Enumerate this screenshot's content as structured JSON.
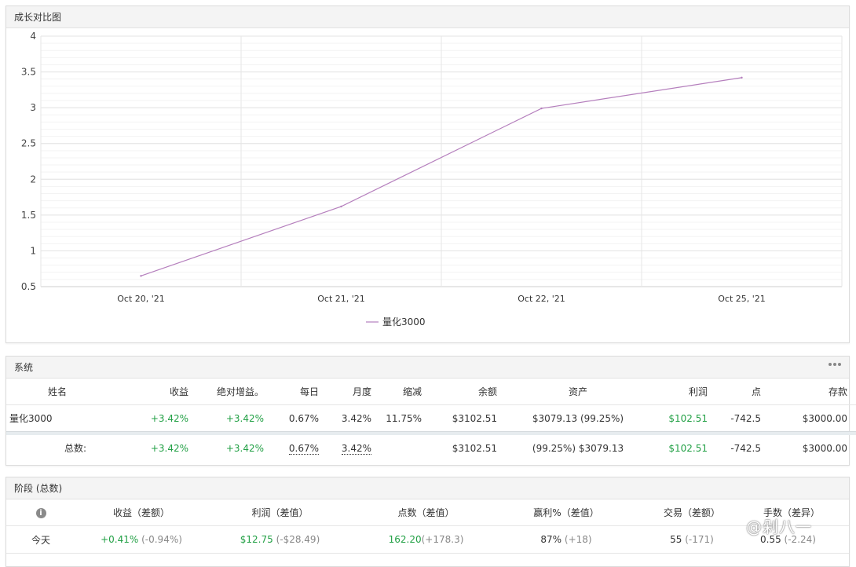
{
  "chart_panel": {
    "title": "成长对比图"
  },
  "chart_data": {
    "type": "line",
    "x": [
      "Oct 20, '21",
      "Oct 21, '21",
      "Oct 22, '21",
      "Oct 25, '21"
    ],
    "series": [
      {
        "name": "量化3000",
        "values": [
          0.65,
          1.62,
          2.99,
          3.42
        ],
        "color": "#b57fbd"
      }
    ],
    "yticks": [
      "4",
      "3.5",
      "3",
      "2.5",
      "2",
      "1.5",
      "1",
      "0.5"
    ],
    "ylim": [
      0.5,
      4
    ],
    "grid": true,
    "legend": "bottom-center"
  },
  "system": {
    "title": "系统",
    "headers": [
      "姓名",
      "收益",
      "绝对增益。",
      "每日",
      "月度",
      "缩减",
      "余额",
      "资产",
      "利润",
      "点",
      "存款"
    ],
    "row": [
      "量化3000",
      "+3.42%",
      "+3.42%",
      "0.67%",
      "3.42%",
      "11.75%",
      "$3102.51",
      "$3079.13 (99.25%)",
      "$102.51",
      "-742.5",
      "$3000.00"
    ],
    "total": [
      "总数:",
      "+3.42%",
      "+3.42%",
      "0.67%",
      "3.42%",
      "",
      "$3102.51",
      "(99.25%) $3079.13",
      "$102.51",
      "-742.5",
      "$3000.00"
    ]
  },
  "stage": {
    "title": "阶段 (总数)",
    "info_icon": "info-icon",
    "headers": [
      "收益（差额）",
      "利润（差值）",
      "点数（差值）",
      "赢利%（差值）",
      "交易（差额）",
      "手数（差异）"
    ],
    "row": {
      "label": "今天",
      "gain": "+0.41%",
      "gain_diff": "(-0.94%)",
      "profit": "$12.75",
      "profit_diff": "(-$28.49)",
      "pips": "162.20",
      "pips_diff": "(+178.3)",
      "win": "87%",
      "win_diff": "(+18)",
      "trades": "55",
      "trades_diff": "(-171)",
      "lots": "0.55",
      "lots_diff": "(-2.24)"
    }
  },
  "watermark": "@剁八一"
}
